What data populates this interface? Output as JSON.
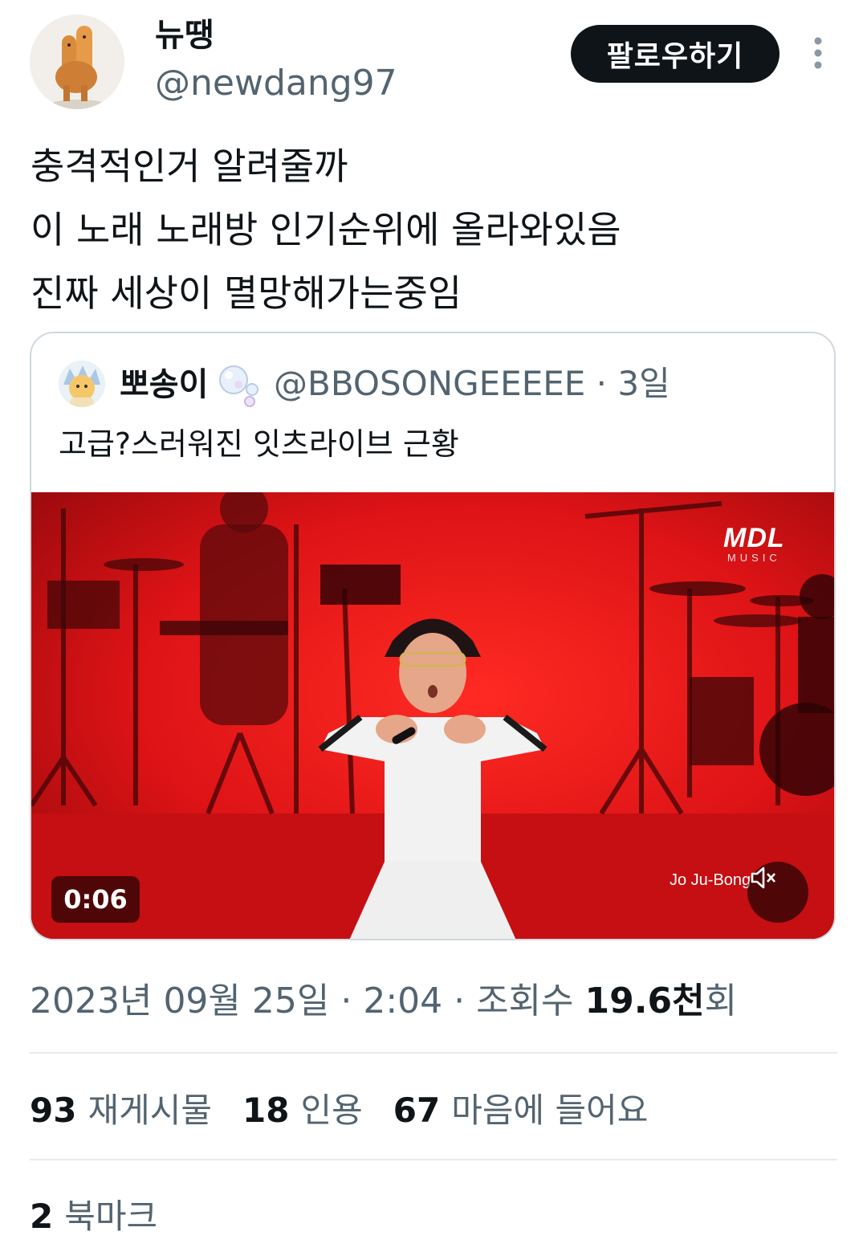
{
  "author": {
    "display_name": "뉴땡",
    "handle": "@newdang97",
    "follow_label": "팔로우하기"
  },
  "tweet": {
    "lines": [
      "충격적인거 알려줄까",
      "이 노래 노래방 인기순위에 올라와있음",
      "진짜 세상이 멸망해가는중임"
    ]
  },
  "quote": {
    "name": "뽀송이",
    "handle_time": "@BBOSONGEEEEE · 3일",
    "text": "고급?스러워진 잇츠라이브 근황",
    "video": {
      "duration": "0:06",
      "brand": "MDL",
      "brand_sub": "MUSIC",
      "watermark": "Jo Ju-Bong"
    }
  },
  "meta": {
    "datetime": "2023년 09월 25일 · 2:04 · 조회수 ",
    "views": "19.6천",
    "views_suffix": "회"
  },
  "stats": {
    "retweets": "93",
    "retweets_label": "재게시물",
    "quotes": "18",
    "quotes_label": "인용",
    "likes": "67",
    "likes_label": "마음에 들어요"
  },
  "bookmarks": {
    "count": "2",
    "label": "북마크"
  },
  "colors": {
    "text": "#0f1419",
    "secondary": "#536471",
    "border": "#cfd9de",
    "stage_red": "#d8151a"
  }
}
